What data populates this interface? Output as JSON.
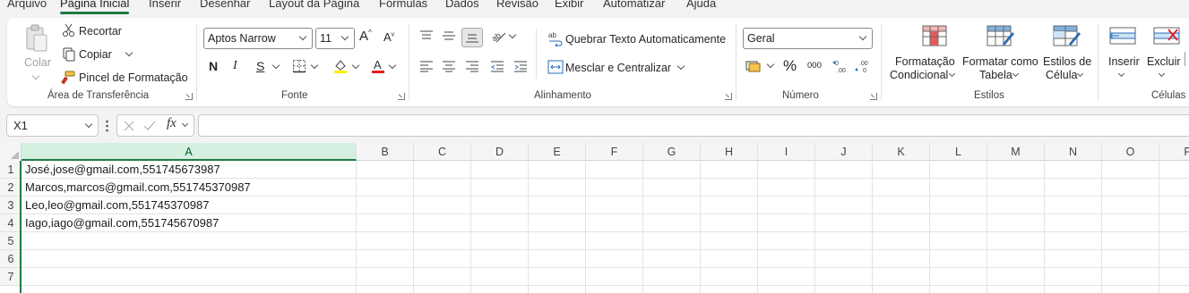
{
  "menu": {
    "tabs": [
      {
        "label": "Arquivo"
      },
      {
        "label": "Página Inicial",
        "active": true
      },
      {
        "label": "Inserir"
      },
      {
        "label": "Desenhar"
      },
      {
        "label": "Layout da Página"
      },
      {
        "label": "Fórmulas"
      },
      {
        "label": "Dados"
      },
      {
        "label": "Revisão"
      },
      {
        "label": "Exibir"
      },
      {
        "label": "Automatizar"
      },
      {
        "label": "Ajuda"
      }
    ]
  },
  "ribbon": {
    "clipboard": {
      "paste": "Colar",
      "cut": "Recortar",
      "copy": "Copiar",
      "format_painter": "Pincel de Formatação",
      "group_label": "Área de Transferência"
    },
    "font": {
      "font_name": "Aptos Narrow",
      "font_size": "11",
      "bold": "N",
      "italic": "I",
      "underline": "S",
      "group_label": "Fonte"
    },
    "alignment": {
      "wrap_text": "Quebrar Texto Automaticamente",
      "merge_center": "Mesclar e Centralizar",
      "group_label": "Alinhamento"
    },
    "number": {
      "format": "Geral",
      "percent": "%",
      "thousands": "000",
      "group_label": "Número"
    },
    "styles": {
      "conditional_line1": "Formatação",
      "conditional_line2": "Condicional",
      "table_line1": "Formatar como",
      "table_line2": "Tabela",
      "cell_line1": "Estilos de",
      "cell_line2": "Célula",
      "group_label": "Estilos"
    },
    "cells": {
      "insert": "Inserir",
      "delete": "Excluir",
      "group_label": "Células"
    }
  },
  "formula_bar": {
    "name_box": "X1",
    "fx": "fx",
    "value": ""
  },
  "sheet": {
    "columns": [
      "A",
      "B",
      "C",
      "D",
      "E",
      "F",
      "G",
      "H",
      "I",
      "J",
      "K",
      "L",
      "M",
      "N",
      "O",
      "P"
    ],
    "rows": [
      "1",
      "2",
      "3",
      "4",
      "5",
      "6",
      "7"
    ],
    "cells": [
      "José,jose@gmail.com,551745673987",
      "Marcos,marcos@gmail.com,551745370987",
      "Leo,leo@gmail.com,551745370987",
      "Iago,iago@gmail.com,551745670987"
    ]
  }
}
